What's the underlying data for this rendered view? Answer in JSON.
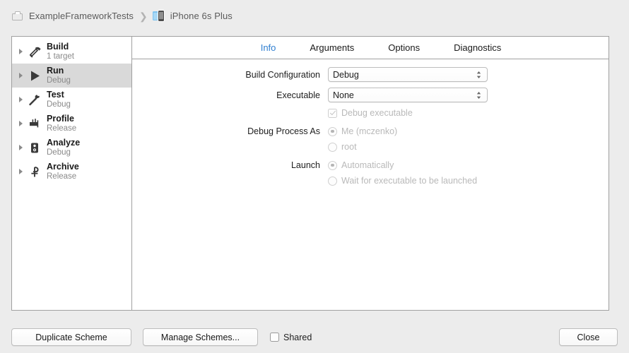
{
  "breadcrumb": {
    "project": "ExampleFrameworkTests",
    "separator": "❯",
    "destination": "iPhone 6s Plus",
    "project_icon": "project-box-icon",
    "destination_icon": "simulator-device-icon"
  },
  "sidebar": {
    "items": [
      {
        "title": "Build",
        "subtitle": "1 target",
        "icon": "hammer-icon",
        "selected": false
      },
      {
        "title": "Run",
        "subtitle": "Debug",
        "icon": "play-icon",
        "selected": true
      },
      {
        "title": "Test",
        "subtitle": "Debug",
        "icon": "wrench-icon",
        "selected": false
      },
      {
        "title": "Profile",
        "subtitle": "Release",
        "icon": "gauge-icon",
        "selected": false
      },
      {
        "title": "Analyze",
        "subtitle": "Debug",
        "icon": "microscope-icon",
        "selected": false
      },
      {
        "title": "Archive",
        "subtitle": "Release",
        "icon": "archive-icon",
        "selected": false
      }
    ]
  },
  "tabs": [
    {
      "label": "Info",
      "active": true
    },
    {
      "label": "Arguments",
      "active": false
    },
    {
      "label": "Options",
      "active": false
    },
    {
      "label": "Diagnostics",
      "active": false
    }
  ],
  "form": {
    "build_configuration": {
      "label": "Build Configuration",
      "value": "Debug"
    },
    "executable": {
      "label": "Executable",
      "value": "None"
    },
    "debug_executable": {
      "label": "Debug executable",
      "checked": true,
      "enabled": false
    },
    "debug_process_as": {
      "label": "Debug Process As",
      "options": [
        {
          "label": "Me (mczenko)",
          "selected": true
        },
        {
          "label": "root",
          "selected": false
        }
      ]
    },
    "launch": {
      "label": "Launch",
      "options": [
        {
          "label": "Automatically",
          "selected": true
        },
        {
          "label": "Wait for executable to be launched",
          "selected": false
        }
      ]
    }
  },
  "bottom_bar": {
    "duplicate_scheme": "Duplicate Scheme",
    "manage_schemes": "Manage Schemes...",
    "shared_label": "Shared",
    "shared_checked": false,
    "close": "Close"
  },
  "colors": {
    "accent_blue": "#2f7fd1",
    "window_bg": "#ececec",
    "panel_bg": "#ffffff",
    "selection_gray": "#d9d9d9",
    "border_gray": "#a0a0a0",
    "disabled_text": "#b9b9b9"
  }
}
